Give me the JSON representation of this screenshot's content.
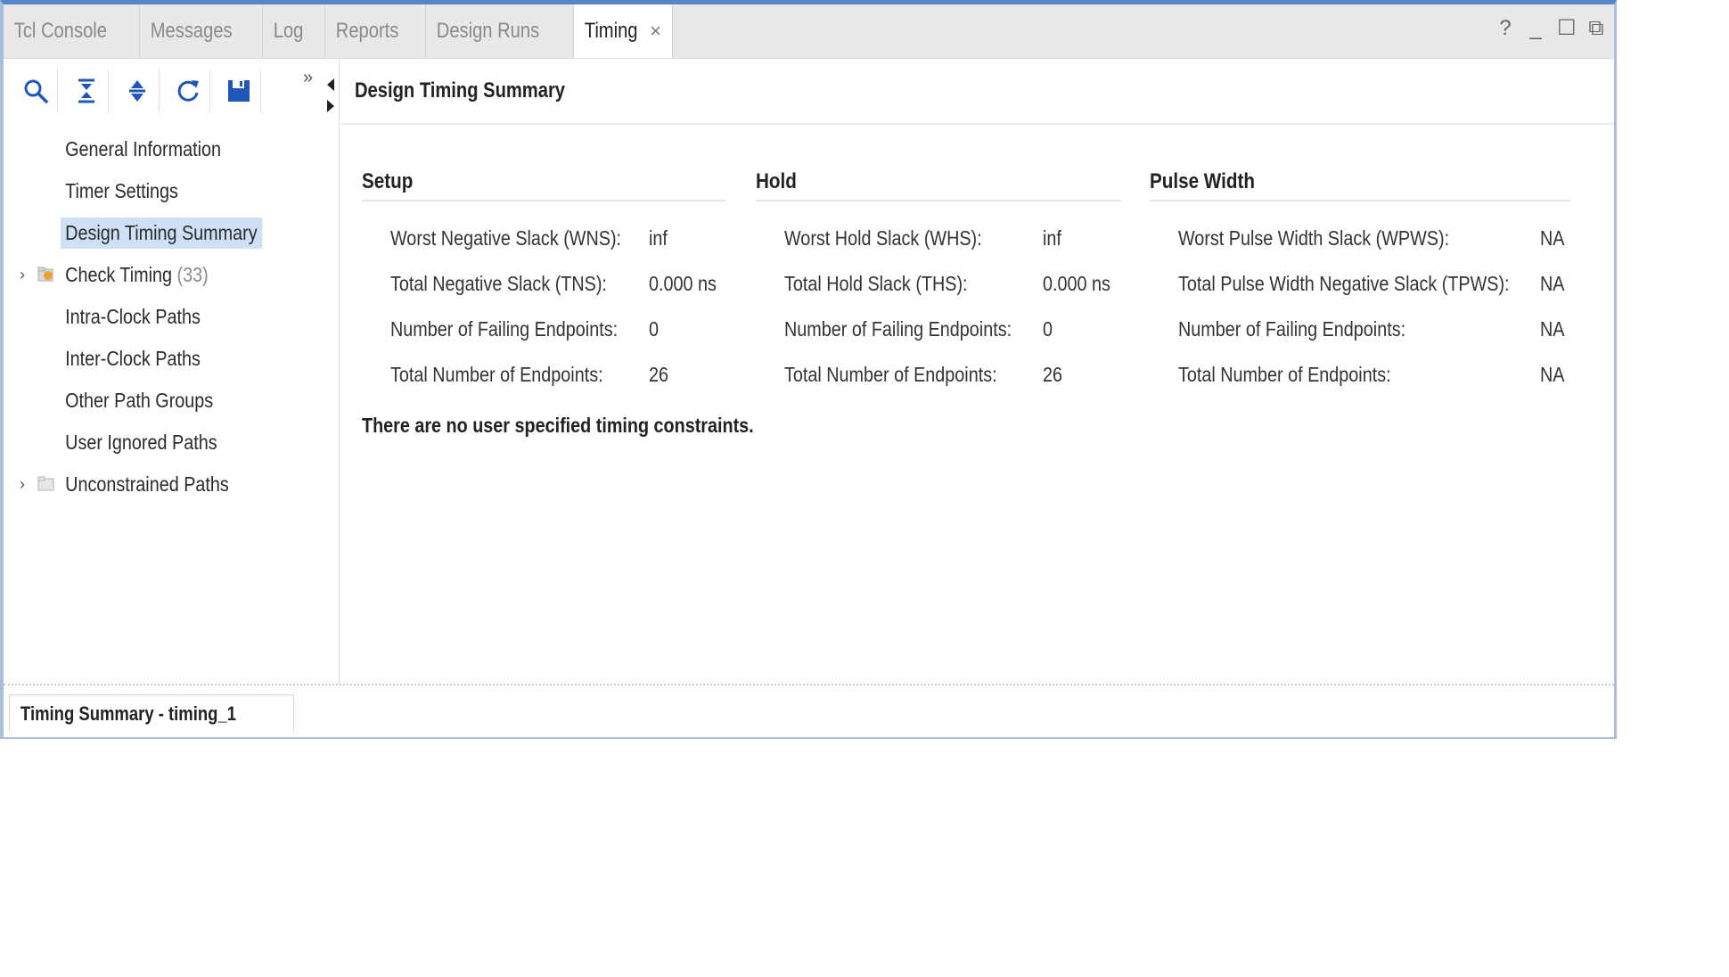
{
  "tabs": [
    {
      "label": "Tcl Console"
    },
    {
      "label": "Messages"
    },
    {
      "label": "Log"
    },
    {
      "label": "Reports"
    },
    {
      "label": "Design Runs"
    },
    {
      "label": "Timing",
      "active": true
    }
  ],
  "window_controls": {
    "help": "?",
    "minimize": "_",
    "maximize": "☐",
    "restore": "⧉"
  },
  "close_glyph": "×",
  "more_glyph": "»",
  "tree": [
    {
      "label": "General Information"
    },
    {
      "label": "Timer Settings"
    },
    {
      "label": "Design Timing Summary",
      "selected": true
    },
    {
      "label": "Check Timing",
      "count": "(33)",
      "expandable": true
    },
    {
      "label": "Intra-Clock Paths"
    },
    {
      "label": "Inter-Clock Paths"
    },
    {
      "label": "Other Path Groups"
    },
    {
      "label": "User Ignored Paths"
    },
    {
      "label": "Unconstrained Paths",
      "expandable": true
    }
  ],
  "content": {
    "title": "Design Timing Summary",
    "setup": {
      "heading": "Setup",
      "rows": [
        {
          "label": "Worst Negative Slack (WNS):",
          "value": "inf"
        },
        {
          "label": "Total Negative Slack (TNS):",
          "value": "0.000 ns"
        },
        {
          "label": "Number of Failing Endpoints:",
          "value": "0"
        },
        {
          "label": "Total Number of Endpoints:",
          "value": "26"
        }
      ]
    },
    "hold": {
      "heading": "Hold",
      "rows": [
        {
          "label": "Worst Hold Slack (WHS):",
          "value": "inf"
        },
        {
          "label": "Total Hold Slack (THS):",
          "value": "0.000 ns"
        },
        {
          "label": "Number of Failing Endpoints:",
          "value": "0"
        },
        {
          "label": "Total Number of Endpoints:",
          "value": "26"
        }
      ]
    },
    "pulse": {
      "heading": "Pulse Width",
      "rows": [
        {
          "label": "Worst Pulse Width Slack (WPWS):",
          "value": "NA"
        },
        {
          "label": "Total Pulse Width Negative Slack (TPWS):",
          "value": "NA"
        },
        {
          "label": "Number of Failing Endpoints:",
          "value": "NA"
        },
        {
          "label": "Total Number of Endpoints:",
          "value": "NA"
        }
      ]
    },
    "note": "There are no user specified timing constraints."
  },
  "bottom_tab": "Timing Summary - timing_1",
  "colors": {
    "selection": "#cfe0f6",
    "accent": "#1f57b8",
    "window_border": "#5a84c8"
  },
  "icons": [
    "search-icon",
    "collapse-all-icon",
    "expand-all-icon",
    "refresh-icon",
    "save-icon"
  ]
}
